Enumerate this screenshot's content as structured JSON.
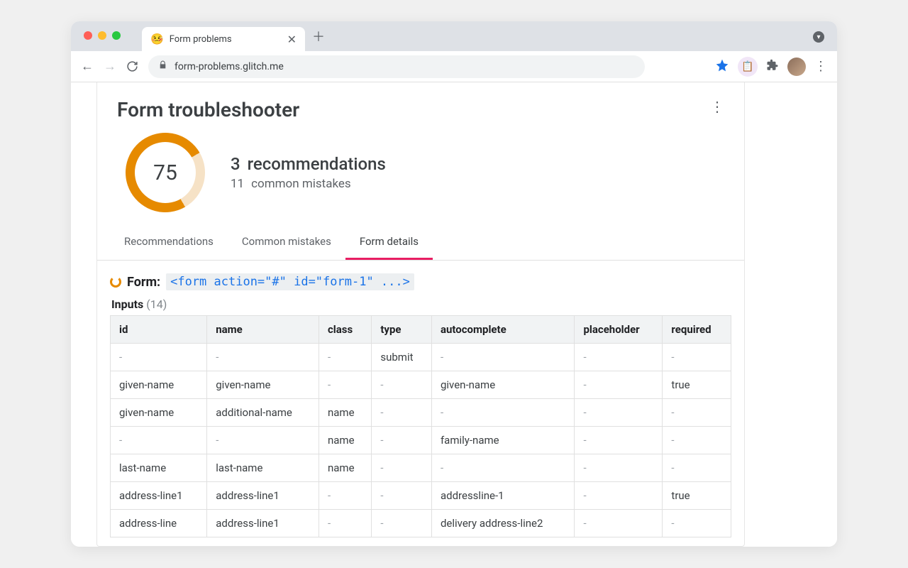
{
  "browser": {
    "tab_title": "Form problems",
    "tab_favicon": "🤒",
    "url": "form-problems.glitch.me"
  },
  "panel": {
    "title": "Form troubleshooter",
    "score": "75",
    "recommendations_count": "3",
    "recommendations_label": "recommendations",
    "mistakes_count": "11",
    "mistakes_label": "common mistakes",
    "tabs": {
      "recommendations": "Recommendations",
      "common_mistakes": "Common mistakes",
      "form_details": "Form details"
    },
    "form_label": "Form:",
    "form_code": "<form action=\"#\" id=\"form-1\" ...>",
    "inputs_label": "Inputs",
    "inputs_count": "(14)",
    "columns": {
      "id": "id",
      "name": "name",
      "class": "class",
      "type": "type",
      "autocomplete": "autocomplete",
      "placeholder": "placeholder",
      "required": "required"
    },
    "rows": [
      {
        "id": "-",
        "name": "-",
        "class": "-",
        "type": "submit",
        "autocomplete": "-",
        "placeholder": "-",
        "required": "-"
      },
      {
        "id": "given-name",
        "name": "given-name",
        "class": "-",
        "type": "-",
        "autocomplete": "given-name",
        "placeholder": "-",
        "required": "true"
      },
      {
        "id": "given-name",
        "name": "additional-name",
        "class": "name",
        "type": "-",
        "autocomplete": "-",
        "placeholder": "-",
        "required": "-"
      },
      {
        "id": "-",
        "name": "-",
        "class": "name",
        "type": "-",
        "autocomplete": "family-name",
        "placeholder": "-",
        "required": "-"
      },
      {
        "id": "last-name",
        "name": "last-name",
        "class": "name",
        "type": "-",
        "autocomplete": "-",
        "placeholder": "-",
        "required": "-"
      },
      {
        "id": "address-line1",
        "name": "address-line1",
        "class": "-",
        "type": "-",
        "autocomplete": "addressline-1",
        "placeholder": "-",
        "required": "true"
      },
      {
        "id": "address-line",
        "name": "address-line1",
        "class": "-",
        "type": "-",
        "autocomplete": "delivery address-line2",
        "placeholder": "-",
        "required": "-"
      }
    ]
  }
}
